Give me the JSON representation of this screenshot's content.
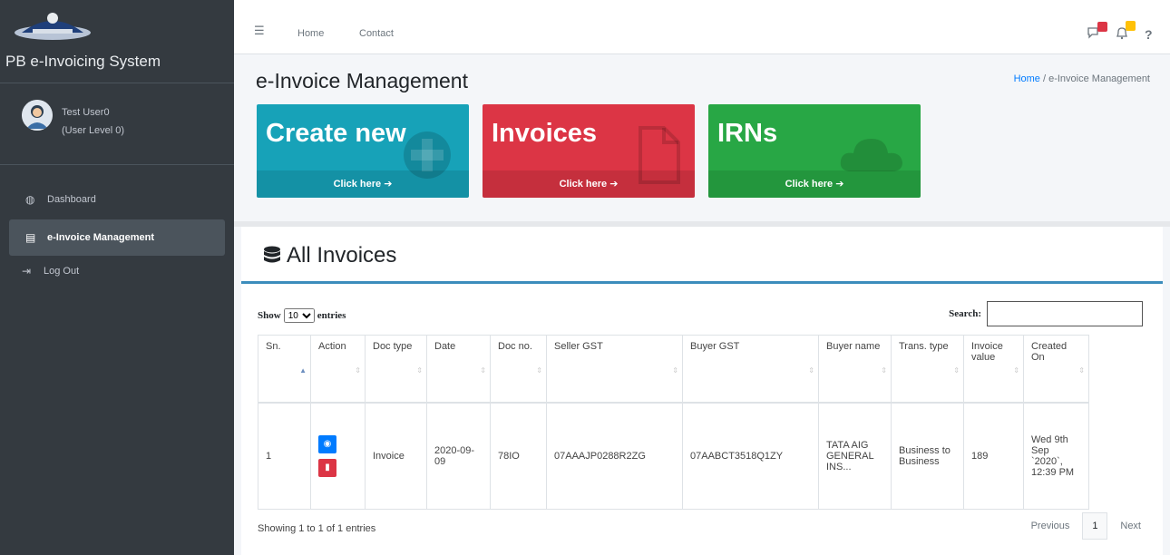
{
  "sidebar": {
    "brand": "PB e-Invoicing System",
    "user_name": "Test User0",
    "user_level": "(User Level 0)",
    "items": [
      {
        "label": "Dashboard",
        "icon": "tachometer-icon"
      },
      {
        "label": "e-Invoice Management",
        "icon": "file-icon",
        "active": true
      },
      {
        "label": "Log Out",
        "icon": "logout-icon"
      }
    ]
  },
  "topbar": {
    "links": [
      "Home",
      "Contact"
    ],
    "help": "?"
  },
  "header": {
    "title": "e-Invoice Management",
    "breadcrumb_home": "Home",
    "breadcrumb_sep": "/",
    "breadcrumb_current": "e-Invoice Management"
  },
  "boxes": [
    {
      "title": "Create new",
      "footer": "Click here",
      "color": "#17a2b8",
      "icon": "plus-circle-icon"
    },
    {
      "title": "Invoices",
      "footer": "Click here",
      "color": "#dc3545",
      "icon": "document-icon"
    },
    {
      "title": "IRNs",
      "footer": "Click here",
      "color": "#28a745",
      "icon": "cloud-icon"
    }
  ],
  "card": {
    "title": "All Invoices",
    "show_label": "Show",
    "entries_label": "entries",
    "page_size": "10",
    "search_label": "Search:",
    "search_value": ""
  },
  "table": {
    "headers": [
      "Sn.",
      "Action",
      "Doc type",
      "Date",
      "Doc no.",
      "Seller GST",
      "Buyer GST",
      "Buyer name",
      "Trans. type",
      "Invoice value",
      "Created On"
    ],
    "rows": [
      {
        "sn": "1",
        "doc_type": "Invoice",
        "date": "2020-09-09",
        "doc_no": "78IO",
        "seller_gst": "07AAAJP0288R2ZG",
        "buyer_gst": "07AABCT3518Q1ZY",
        "buyer_name": "TATA AIG GENERAL INS...",
        "trans_type": "Business to Business",
        "invoice_value": "189",
        "created_on": "Wed 9th Sep `2020`, 12:39 PM"
      }
    ]
  },
  "footer": {
    "info": "Showing 1 to 1 of 1 entries",
    "previous": "Previous",
    "page": "1",
    "next": "Next"
  },
  "colors": {
    "sidebar_bg": "#343a40",
    "card_accent": "#3c8dbc",
    "view_button": "#007bff",
    "delete_button": "#dc3545",
    "messages_badge": "#dc3545",
    "notifications_badge": "#ffc107"
  }
}
